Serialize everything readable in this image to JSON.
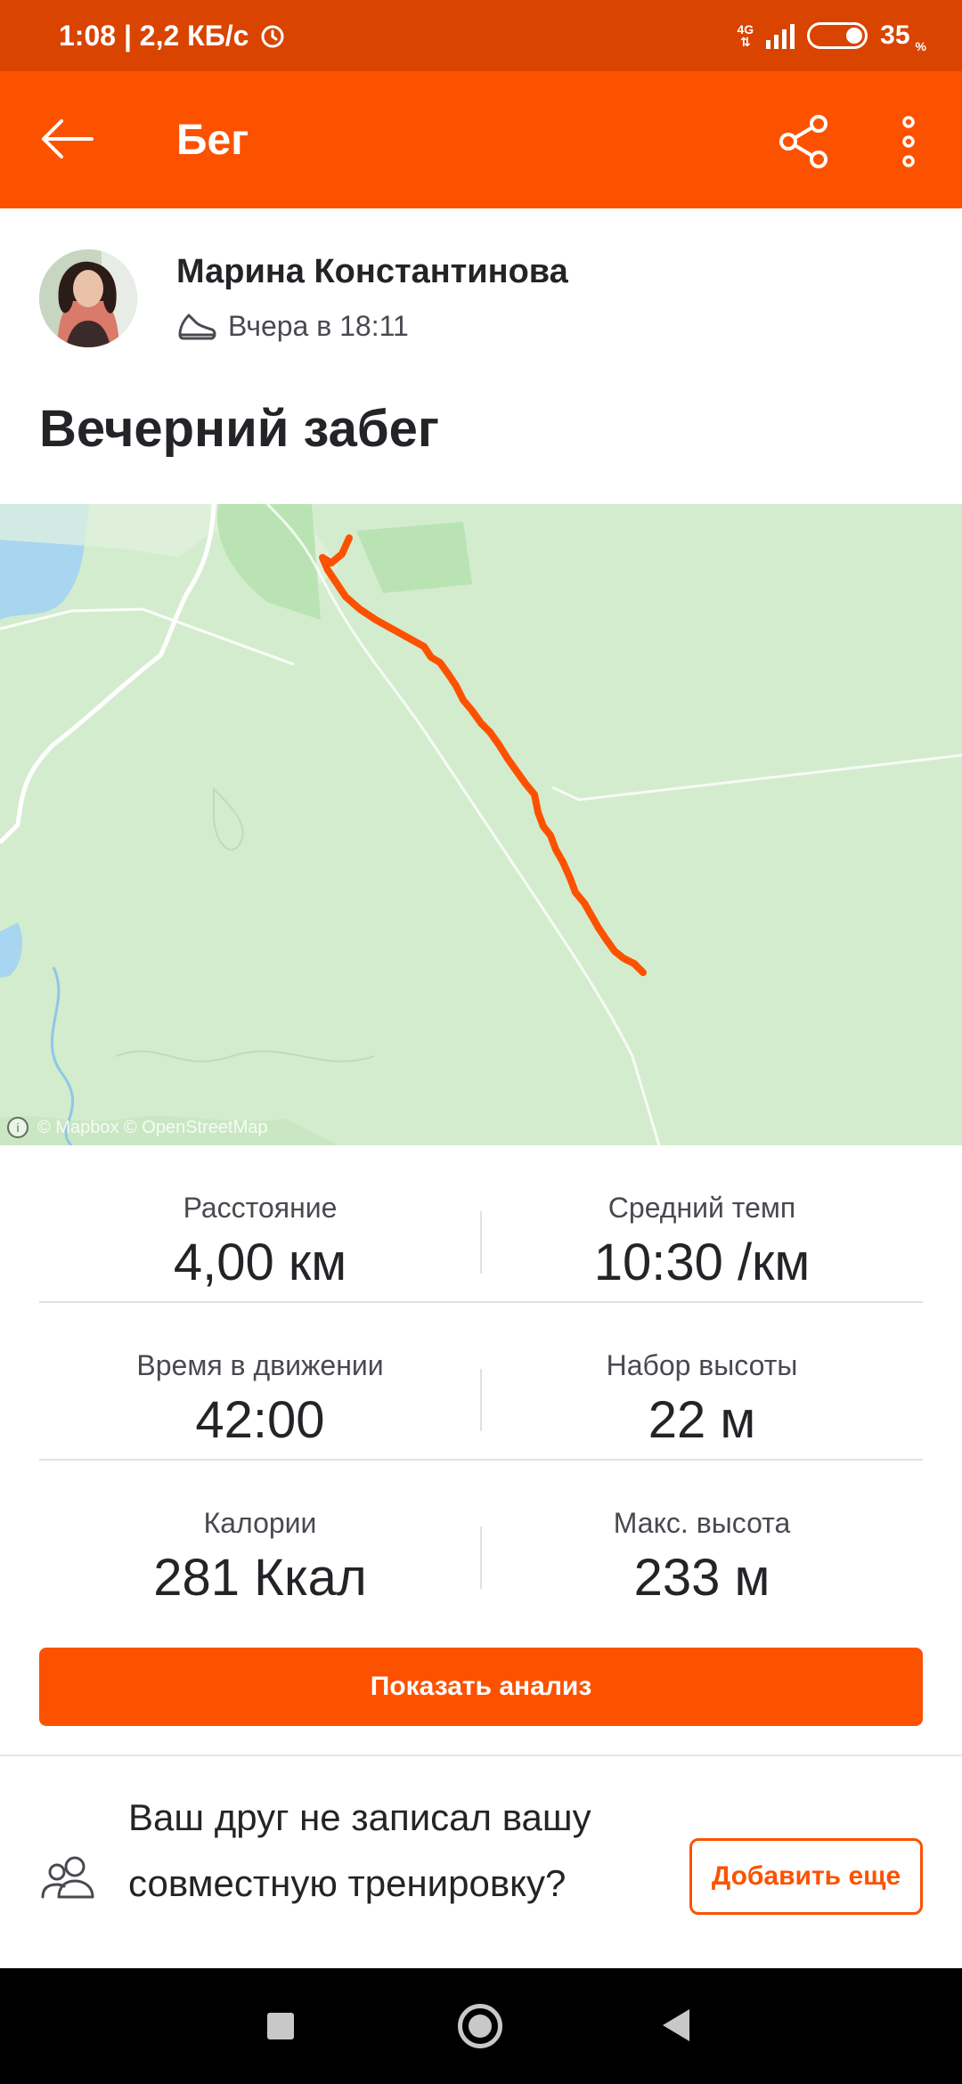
{
  "status_bar": {
    "time_and_speed": "1:08 | 2,2 КБ/с",
    "network": "4G",
    "battery": "35",
    "battery_unit": "%"
  },
  "toolbar": {
    "title": "Бег",
    "icons": [
      "back-arrow-icon",
      "share-icon",
      "more-vertical-icon"
    ]
  },
  "athlete": {
    "name": "Марина Константинова",
    "time": "Вчера в 18:11",
    "activity_icon": "running-shoe-icon"
  },
  "activity": {
    "title": "Вечерний забег"
  },
  "map": {
    "attribution": "© Mapbox © OpenStreetMap",
    "route_color": "#fc5200",
    "water_color": "#a8d5f0",
    "land_color": "#d3ecce"
  },
  "stats": [
    {
      "label": "Расстояние",
      "value": "4,00 км"
    },
    {
      "label": "Средний темп",
      "value": "10:30 /км"
    },
    {
      "label": "Время в движении",
      "value": "42:00"
    },
    {
      "label": "Набор высоты",
      "value": "22 м"
    },
    {
      "label": "Калории",
      "value": "281 Ккал"
    },
    {
      "label": "Макс. высота",
      "value": "233 м"
    }
  ],
  "analysis_button": "Показать анализ",
  "friends": {
    "prompt": "Ваш друг не записал вашу совместную тренировку?",
    "button": "Добавить еще"
  },
  "colors": {
    "accent": "#fc5200",
    "status_bar": "#d94400"
  }
}
